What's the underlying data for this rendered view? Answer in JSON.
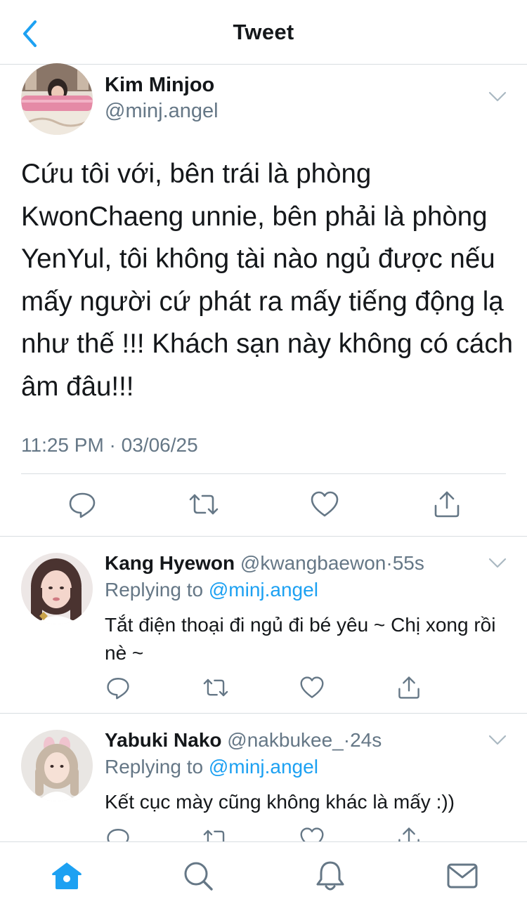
{
  "header": {
    "title": "Tweet"
  },
  "main_tweet": {
    "name": "Kim Minjoo",
    "handle": "@minj.angel",
    "text": "Cứu tôi với, bên trái là phòng KwonChaeng unnie, bên phải là phòng YenYul, tôi không tài nào ngủ được nếu mấy người cứ phát ra mấy tiếng động lạ như thế !!! Khách sạn này không có cách âm đâu!!!",
    "timestamp": "11:25 PM · 03/06/25",
    "icons": [
      "reply-icon",
      "retweet-icon",
      "like-icon",
      "share-icon"
    ]
  },
  "replies": [
    {
      "name": "Kang Hyewon",
      "handle": "@kwangbaewon",
      "dot": "·",
      "time": "55s",
      "replying_prefix": "Replying to",
      "replying_to": "@minj.angel",
      "text": "Tắt điện thoại đi ngủ đi bé yêu ~ Chị xong rồi nè ~"
    },
    {
      "name": "Yabuki Nako",
      "handle": "@nakbukee_",
      "dot": "·",
      "time": "24s",
      "replying_prefix": "Replying to",
      "replying_to": "@minj.angel",
      "text": "Kết cục mày cũng không khác là mấy :))"
    }
  ],
  "tab_bar": [
    "home-icon",
    "search-icon",
    "notifications-icon",
    "messages-icon"
  ],
  "colors": {
    "accent": "#1da1f2",
    "secondary_text": "#657786",
    "primary_text": "#14171a",
    "divider": "#d8dde1"
  }
}
